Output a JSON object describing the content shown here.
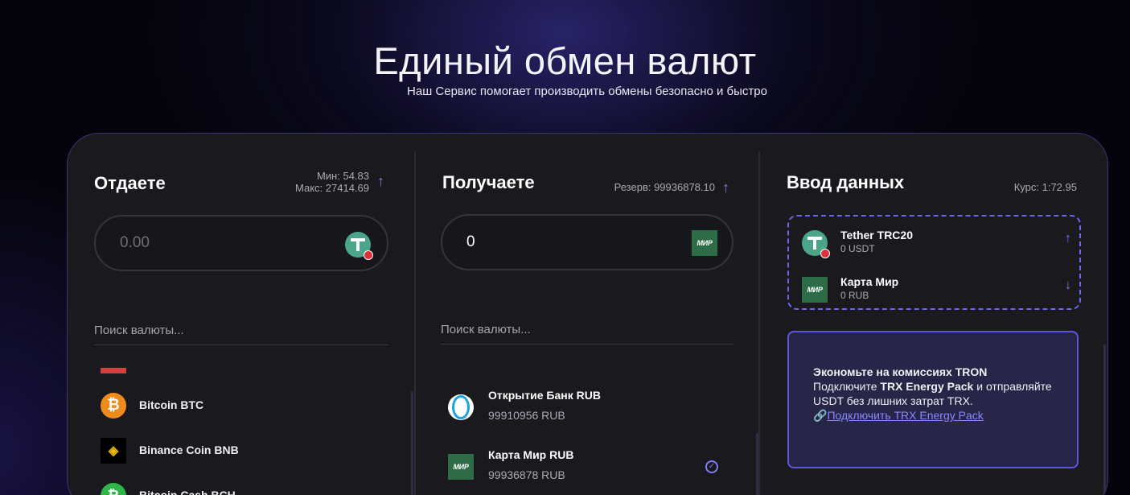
{
  "hero": {
    "title": "Единый обмен валют",
    "subtitle": "Наш Сервис помогает производить обмены безопасно и быстро"
  },
  "give": {
    "title": "Отдаете",
    "min": "Мин: 54.83",
    "max": "Макс: 27414.69",
    "input_placeholder": "0.00",
    "currency_icon": "tether-icon",
    "search_placeholder": "Поиск валюты...",
    "items": [
      {
        "label": "Bitcoin BTC",
        "icon": "bitcoin-icon"
      },
      {
        "label": "Binance Coin BNB",
        "icon": "binance-icon"
      },
      {
        "label": "Bitcoin Cash BCH",
        "icon": "bitcoin-cash-icon"
      }
    ]
  },
  "receive": {
    "title": "Получаете",
    "reserve": "Резерв: 99936878.10",
    "input_value": "0",
    "currency_icon": "mir-icon",
    "search_placeholder": "Поиск валюты...",
    "items": [
      {
        "name": "Открытие Банк RUB",
        "amount": "99910956 RUB",
        "icon": "otkritie-icon"
      },
      {
        "name": "Карта Мир RUB",
        "amount": "99936878 RUB",
        "icon": "mir-icon",
        "selected": true
      }
    ]
  },
  "details": {
    "title": "Ввод данных",
    "rate": "Курс: 1:72.95",
    "from": {
      "name": "Tether TRC20",
      "amount": "0 USDT"
    },
    "to": {
      "name": "Карта Мир",
      "amount": "0 RUB"
    },
    "mir_text": "МИР"
  },
  "promo": {
    "heading": "Экономьте на комиссиях TRON",
    "line1_pre": "Подключите ",
    "line1_bold": "TRX Energy Pack",
    "line1_post": " и отправляйте USDT без лишних затрат TRX.",
    "link_icon": "🔗",
    "link": "Подключить TRX Energy Pack"
  },
  "colors": {
    "accent": "#7c7cf4",
    "card_bg": "#1a1a1e",
    "border": "#3a3870",
    "mir_green": "#2e6b47",
    "tether_green": "#4aa589"
  }
}
